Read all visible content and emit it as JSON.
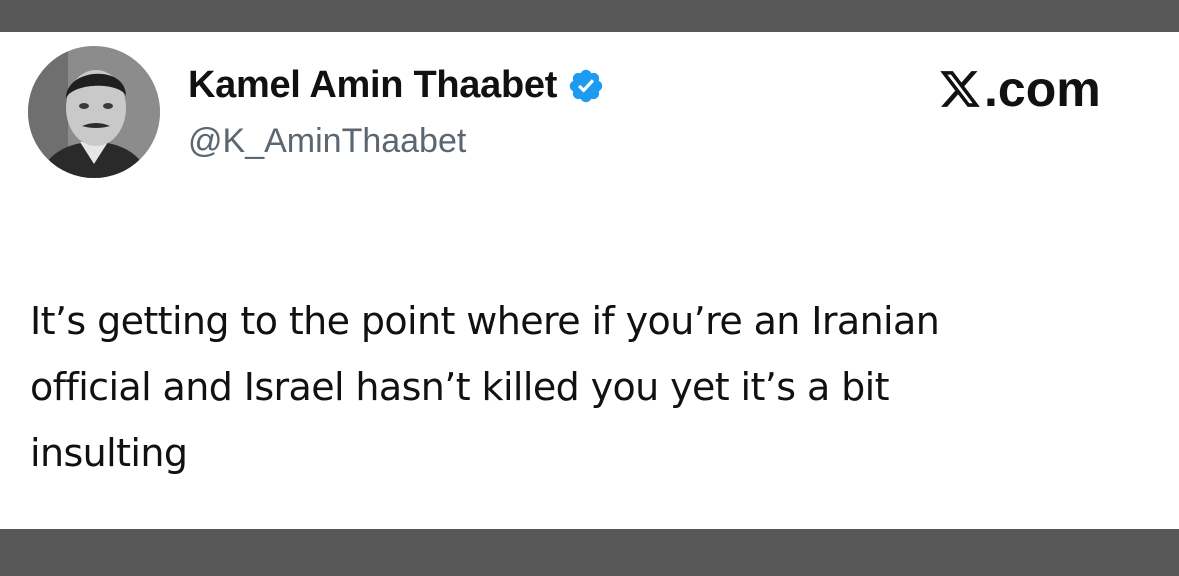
{
  "post": {
    "author_name": "Kamel Amin Thaabet",
    "author_handle": "@K_AminThaabet",
    "verified_icon": "verified-badge-icon",
    "brand_text": ".com",
    "brand_icon": "x-logo-icon",
    "text_lines": [
      "It’s getting to the point where if you’re an Iranian",
      "official and Israel hasn’t killed you yet it’s a bit",
      "insulting"
    ]
  },
  "colors": {
    "frame_bg": "#585858",
    "card_bg": "#ffffff",
    "verified_blue": "#1d9bf0",
    "handle_gray": "#5b6670"
  }
}
